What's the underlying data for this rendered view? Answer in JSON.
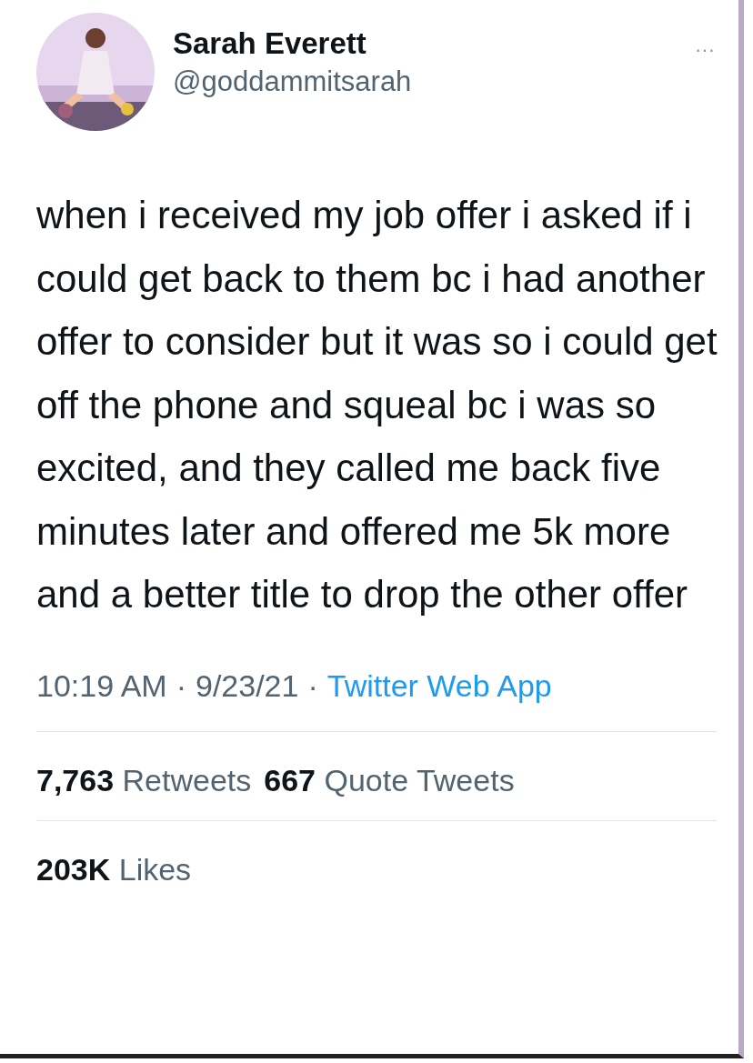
{
  "author": {
    "name": "Sarah Everett",
    "handle": "@goddammitsarah"
  },
  "more": "···",
  "text": "when i received my job offer i asked if i could get back to them bc i had another offer to consider but it was so i could get off the phone and squeal bc i was so excited, and they called me back five minutes later and offered me 5k more and a better title to drop the other offer",
  "meta": {
    "time": "10:19 AM",
    "sep1": "·",
    "date": "9/23/21",
    "sep2": "·",
    "source": "Twitter Web App"
  },
  "stats": [
    {
      "count": "7,763",
      "label": "Retweets"
    },
    {
      "count": "667",
      "label": "Quote Tweets"
    }
  ],
  "likes": {
    "count": "203K",
    "label": "Likes"
  }
}
